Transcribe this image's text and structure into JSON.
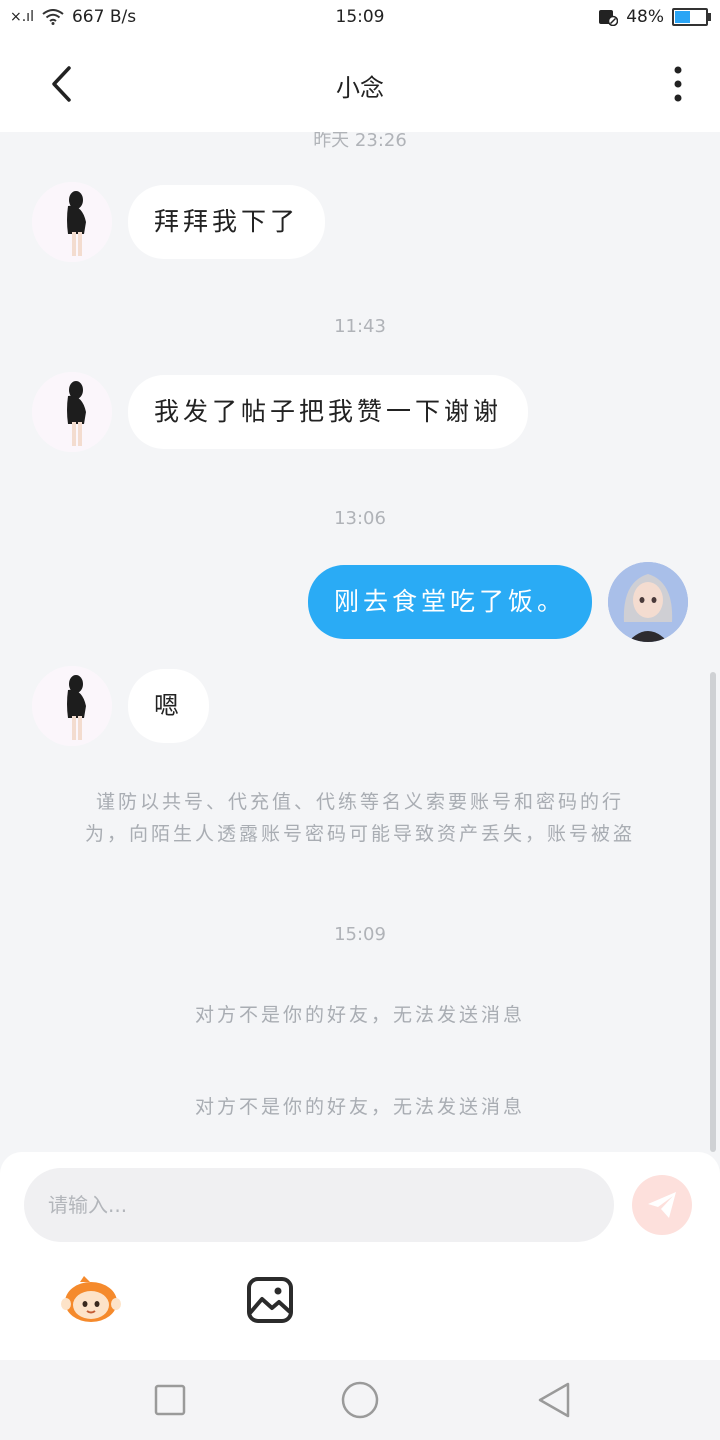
{
  "status_bar": {
    "signal": "×.ıl",
    "net_speed": "667 B/s",
    "time": "15:09",
    "battery_percent": "48%",
    "battery_level": 0.48,
    "accent_color": "#2aa5f5"
  },
  "header": {
    "title": "小念",
    "back_icon": "chevron-left-icon",
    "more_icon": "more-vertical-icon"
  },
  "chat": {
    "top_timestamp": "昨天 23:26",
    "messages": [
      {
        "from": "contact",
        "text": "拜拜我下了"
      },
      {
        "timestamp": "11:43"
      },
      {
        "from": "contact",
        "text": "我发了帖子把我赞一下谢谢"
      },
      {
        "timestamp": "13:06"
      },
      {
        "from": "me",
        "text": "刚去食堂吃了饭。"
      },
      {
        "from": "contact",
        "text": "嗯"
      }
    ],
    "ts_1": "11:43",
    "ts_2": "13:06",
    "ts_3": "15:09",
    "msg_1": "拜拜我下了",
    "msg_2": "我发了帖子把我赞一下谢谢",
    "msg_3": "刚去食堂吃了饭。",
    "msg_4": "嗯",
    "security_notice_line1": "谨防以共号、代充值、代练等名义索要账号和密码的行",
    "security_notice_line2": "为，向陌生人透露账号密码可能导致资产丢失，账号被盗",
    "system_msg_1": "对方不是你的好友，无法发送消息",
    "system_msg_2": "对方不是你的好友，无法发送消息",
    "my_bubble_color": "#2aabf5"
  },
  "input": {
    "placeholder": "请输入...",
    "value": "",
    "send_icon": "paper-plane-icon",
    "emoji_icon": "emoji-sticker-icon",
    "image_icon": "image-icon"
  },
  "nav_bar": {
    "items": [
      "recent-apps-icon",
      "home-icon",
      "back-icon"
    ]
  }
}
